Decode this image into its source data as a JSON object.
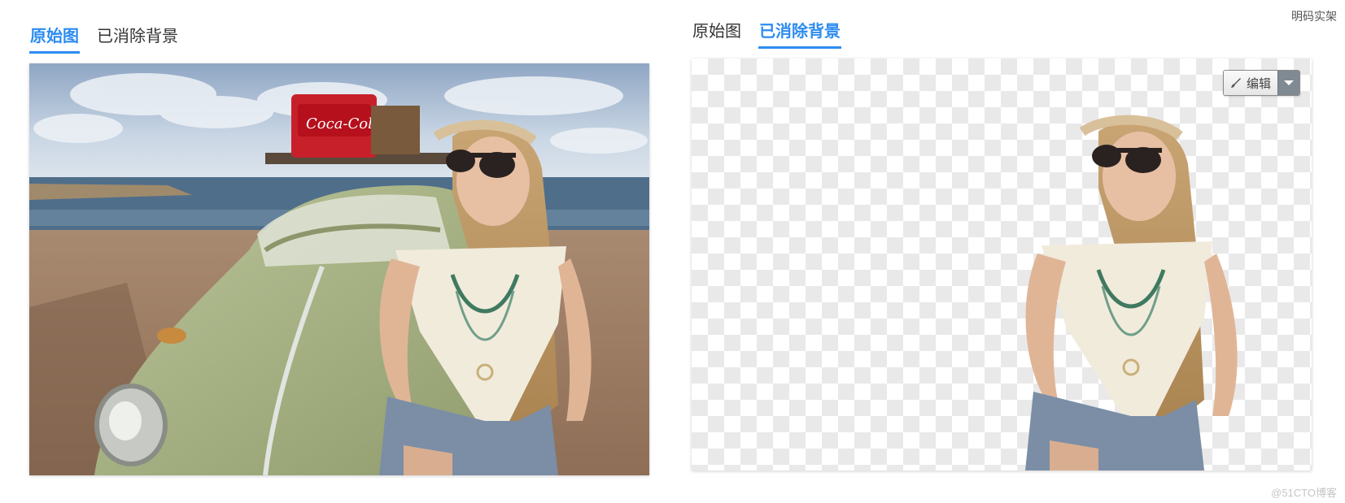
{
  "corner_link": "明码实架",
  "left_panel": {
    "tabs": [
      {
        "label": "原始图",
        "active": true
      },
      {
        "label": "已消除背景",
        "active": false
      }
    ]
  },
  "right_panel": {
    "tabs": [
      {
        "label": "原始图",
        "active": false
      },
      {
        "label": "已消除背景",
        "active": true
      }
    ],
    "edit_label": "编辑"
  },
  "watermark": "@51CTO博客",
  "colors": {
    "accent": "#2d8cf0",
    "checker": "#e9e9e9",
    "edit_caret": "#7f8a93"
  }
}
